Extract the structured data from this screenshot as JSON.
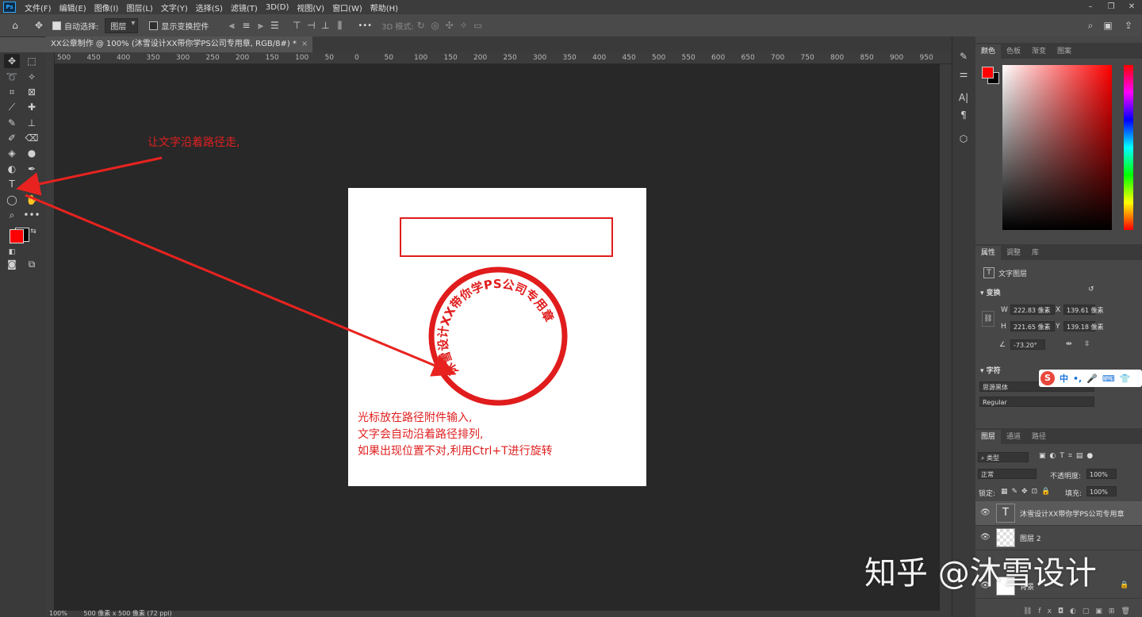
{
  "menu": {
    "logo": "Ps",
    "items": [
      "文件(F)",
      "编辑(E)",
      "图像(I)",
      "图层(L)",
      "文字(Y)",
      "选择(S)",
      "滤镜(T)",
      "3D(D)",
      "视图(V)",
      "窗口(W)",
      "帮助(H)"
    ]
  },
  "window_controls": {
    "minimize": "–",
    "restore": "❐",
    "close": "✕"
  },
  "options": {
    "auto_select_label": "自动选择:",
    "auto_select_value": "图层",
    "show_transform_label": "显示变换控件",
    "mode_3d": "3D 模式:",
    "more": "•••"
  },
  "document": {
    "tab_title": "XX公章制作 @ 100% (沐雪设计XX带你学PS公司专用章, RGB/8#) *",
    "zoom": "100%",
    "size": "500 像素 x 500 像素 (72 ppi)"
  },
  "ruler": {
    "h_labels": [
      "500",
      "450",
      "400",
      "350",
      "300",
      "250",
      "200",
      "150",
      "100",
      "50",
      "0",
      "50",
      "100",
      "150",
      "200",
      "250",
      "300",
      "350",
      "400",
      "450",
      "500",
      "550",
      "600",
      "650",
      "700",
      "750",
      "800",
      "850",
      "900",
      "950"
    ]
  },
  "canvas": {
    "stamp_text": "沐雪设计XX带你学PS公司专用章",
    "annotation_top": "让文字沿着路径走,",
    "annotation_bottom": [
      "光标放在路径附件输入,",
      "文字会自动沿着路径排列,",
      "如果出现位置不对,利用Ctrl+T进行旋转"
    ],
    "accent": "#e01c1c"
  },
  "color_panel": {
    "tabs": [
      "颜色",
      "色板",
      "渐变",
      "图案"
    ],
    "foreground": "#ff0000",
    "background": "#000000"
  },
  "properties": {
    "tabs": [
      "属性",
      "调整",
      "库"
    ],
    "layer_type": "文字图层",
    "transform_title": "变换",
    "w_label": "W",
    "w": "222.83 像素",
    "x_label": "X",
    "x": "139.61 像素",
    "h_label": "H",
    "h": "221.65 像素",
    "y_label": "Y",
    "y": "139.18 像素",
    "angle": "-73.20°",
    "char_title": "字符",
    "font": "思源黑体",
    "style": "Regular"
  },
  "ime": {
    "label_zh": "中",
    "punct": "•,"
  },
  "layers": {
    "tabs": [
      "图层",
      "通道",
      "路径"
    ],
    "filter": "类型",
    "blend": "正常",
    "opacity_label": "不透明度:",
    "opacity": "100%",
    "lock_label": "锁定:",
    "fill_label": "填充:",
    "fill": "100%",
    "items": [
      {
        "name": "沐雪设计XX带你学PS公司专用章",
        "thumb": "T"
      },
      {
        "name": "图层 2",
        "thumb": ""
      },
      {
        "name": "背景",
        "thumb": ""
      }
    ]
  },
  "watermark": "知乎 @沐雪设计"
}
